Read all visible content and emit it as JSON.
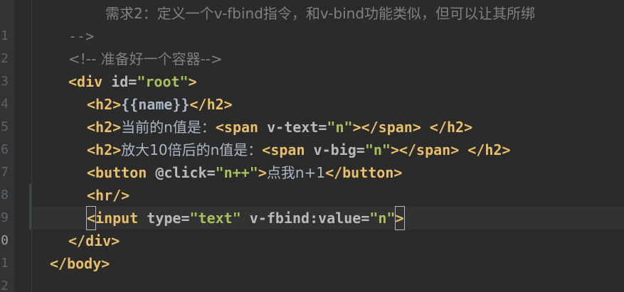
{
  "editor": {
    "line_numbers": [
      "1",
      "2",
      "3",
      "4",
      "5",
      "6",
      "7",
      "8",
      "9",
      "0",
      "1",
      "2"
    ],
    "lines": {
      "l1": {
        "comment": "需求2：定义一个v-fbind指令，和v-bind功能类似，但可以让其所绑"
      },
      "l2": {
        "comment": "-->"
      },
      "l3": {
        "comment": "<!-- 准备好一个容器-->"
      },
      "l4": {
        "open": "<div",
        "attr": " id=",
        "val": "\"root\"",
        "close": ">"
      },
      "l5": {
        "open": "<h2>",
        "mustache": "{{name}}",
        "close": "</h2>"
      },
      "l6": {
        "open": "<h2>",
        "text": "当前的n值是：",
        "span_open": "<span",
        "attr": " v-text=",
        "val": "\"n\"",
        "span_close": "></span>",
        "end": " </h2>"
      },
      "l7": {
        "open": "<h2>",
        "text": "放大10倍后的n值是：",
        "span_open": "<span",
        "attr": " v-big=",
        "val": "\"n\"",
        "span_close": "></span>",
        "end": " </h2>"
      },
      "l8": {
        "open": "<button",
        "attr": " @click=",
        "val": "\"n++\"",
        "mid": ">",
        "text": "点我n+1",
        "close": "</button>"
      },
      "l9": {
        "tag": "<hr/>"
      },
      "l10": {
        "lt": "<",
        "open": "input",
        "attr1": " type=",
        "val1": "\"text\"",
        "attr2": " v-fbind:value=",
        "val2": "\"n\"",
        "gt": ">"
      },
      "l11": {
        "tag": "</div>"
      },
      "l12": {
        "tag": "</body>"
      }
    }
  }
}
